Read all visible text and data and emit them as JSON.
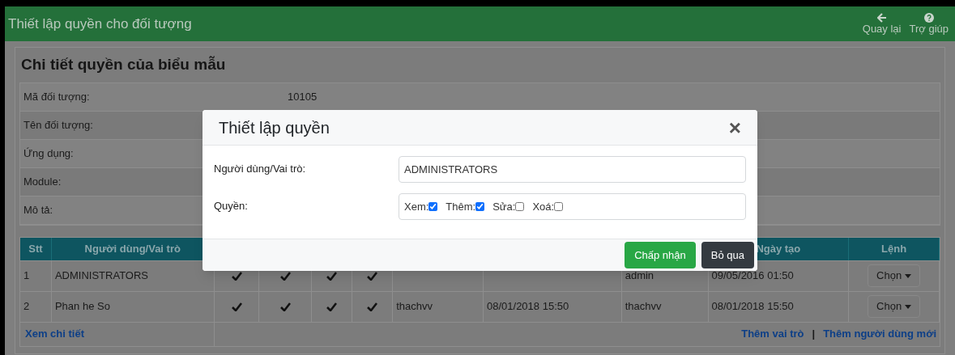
{
  "header": {
    "title": "Thiết lập quyền cho đối tượng",
    "actions": [
      {
        "kind": "back",
        "label": "Quay lại"
      },
      {
        "kind": "help",
        "label": "Trợ giúp"
      }
    ]
  },
  "panel": {
    "title": "Chi tiết quyền của biểu mẫu",
    "fields": [
      {
        "label": "Mã đối tượng:",
        "value": "10105"
      },
      {
        "label": "Tên đối tượng:"
      },
      {
        "label": "Ứng dụng:"
      },
      {
        "label": "Module:"
      },
      {
        "label": "Mô tả:"
      }
    ]
  },
  "table": {
    "columns": [
      "Stt",
      "Người dùng/Vai trò",
      "",
      "",
      "",
      "",
      "",
      "",
      "",
      "Ngày tạo",
      "Lệnh"
    ],
    "rows": [
      {
        "cells": [
          "1",
          "ADMINISTRATORS",
          "",
          "",
          "",
          "",
          "",
          "",
          "admin",
          "09/05/2016 01:50"
        ],
        "checks": [
          true,
          true,
          true,
          true
        ],
        "action": "Chọn"
      },
      {
        "cells": [
          "2",
          "Phan he So",
          "",
          "",
          "",
          "",
          "thachvv",
          "08/01/2018 15:50",
          "thachvv",
          "08/01/2018 15:50"
        ],
        "checks": [
          true,
          true,
          true,
          true
        ],
        "action": "Chọn"
      }
    ],
    "footer_link": "Xem chi tiết",
    "footer_actions": [
      "Thêm vai trò",
      "Thêm người dùng mới"
    ],
    "separator": "|"
  },
  "dialog": {
    "title": "Thiết lập quyền",
    "close": "×",
    "user_label": "Người dùng/Vai trò:",
    "user_value": "ADMINISTRATORS",
    "rights_label": "Quyền:",
    "rights": [
      {
        "label": "Xem:",
        "checked": true
      },
      {
        "label": "Thêm:",
        "checked": true
      },
      {
        "label": "Sửa:",
        "checked": false
      },
      {
        "label": "Xoá:",
        "checked": false
      }
    ],
    "buttons": [
      {
        "kind": "primary",
        "label": "Chấp nhận"
      },
      {
        "kind": "secondary",
        "label": "Bỏ qua"
      }
    ]
  }
}
